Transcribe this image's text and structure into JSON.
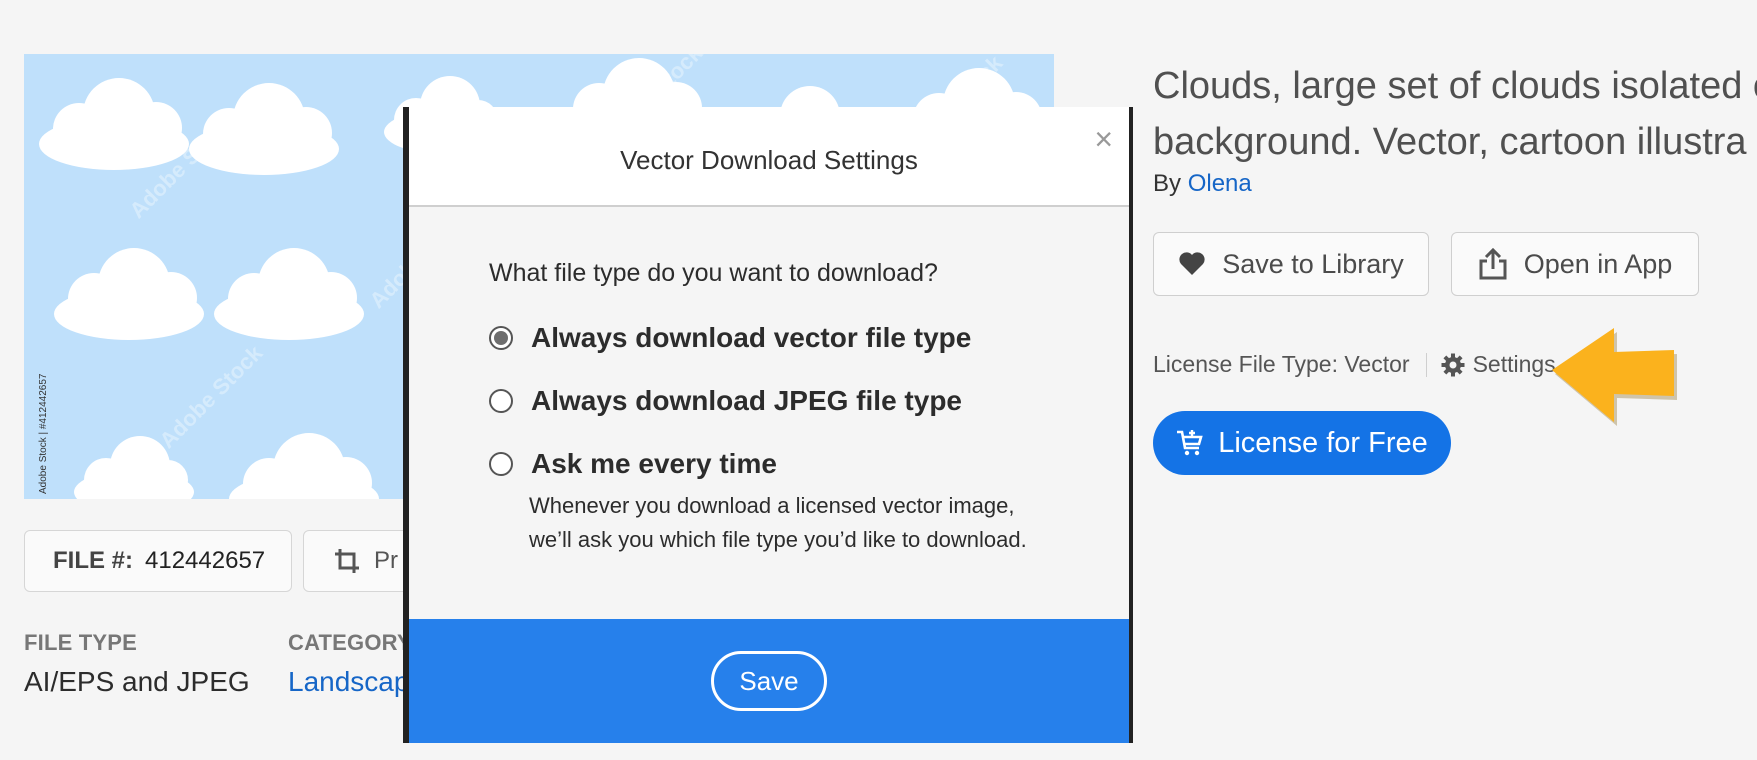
{
  "preview": {
    "watermark": "Adobe Stock",
    "side_credit": "Adobe Stock | #412442657"
  },
  "file_info": {
    "file_label": "FILE #:",
    "file_number": "412442657",
    "preview_label": "Pr"
  },
  "meta": {
    "file_type_label": "FILE TYPE",
    "file_type_value": "AI/EPS and JPEG",
    "category_label": "CATEGORY",
    "category_value": "Landscap"
  },
  "asset": {
    "title_line1": "Clouds, large set of clouds isolated o",
    "title_line2": "background. Vector, cartoon illustra",
    "by_label": "By",
    "author": "Olena"
  },
  "actions": {
    "save_to_library": "Save to Library",
    "open_in_app": "Open in App",
    "license_file_type": "License File Type: Vector",
    "settings": "Settings",
    "license_button": "License for Free"
  },
  "modal": {
    "title": "Vector Download Settings",
    "close": "×",
    "question": "What file type do you want to download?",
    "options": [
      {
        "label": "Always download vector file type",
        "checked": true
      },
      {
        "label": "Always download JPEG file type",
        "checked": false
      },
      {
        "label": "Ask me every time",
        "checked": false
      }
    ],
    "ask_description": "Whenever you download a licensed vector image, we’ll ask you which file type you’d like to download.",
    "save_label": "Save"
  },
  "colors": {
    "accent_blue": "#1473e6",
    "footer_blue": "#2680eb",
    "link_blue": "#1666c7",
    "sky": "#bfe0fb",
    "arrow_yellow": "#fbb21d"
  }
}
